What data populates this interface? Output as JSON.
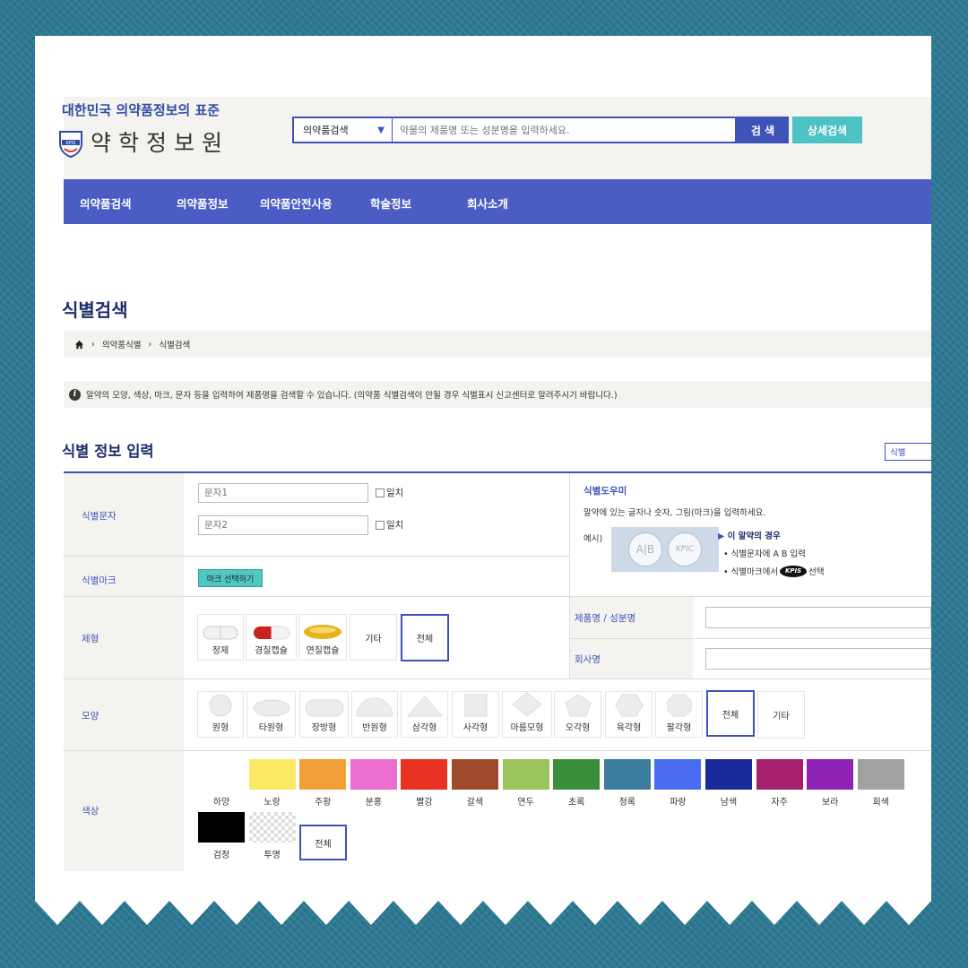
{
  "header": {
    "tagline": "대한민국 의약품정보의 표준",
    "logo_name": "약학정보원",
    "logo_emblem_text": "KPIS"
  },
  "search": {
    "category": "의약품검색",
    "placeholder": "약물의 제품명 또는 성분명을 입력하세요.",
    "search_button": "검 색",
    "advanced_button": "상세검색"
  },
  "nav": {
    "items": [
      "의약품검색",
      "의약품정보",
      "의약품안전사용",
      "학술정보",
      "회사소개"
    ]
  },
  "page": {
    "title": "식별검색",
    "breadcrumb": [
      "의약품식별",
      "식별검색"
    ],
    "info_icon": "i",
    "info": "알약의 모양, 색상, 마크, 문자 등을 입력하여 제품명을 검색할 수 있습니다. (의약품 식별검색이 안될 경우 식별표시 신고센터로 알려주시기 바랍니다.)",
    "section_title": "식별 정보 입력",
    "section_button": "식별"
  },
  "form": {
    "imprint_label": "식별문자",
    "imprint1_placeholder": "문자1",
    "imprint2_placeholder": "문자2",
    "exact_match": "일치",
    "mark_label": "식별마크",
    "mark_button": "마크 선택하기",
    "help": {
      "title": "식별도우미",
      "text": "알약에 있는 글자나 숫자, 그림(마크)을 입력하세요.",
      "example": "예시)",
      "pill1_text": "A|B",
      "pill2_text": "KPIC",
      "case_title": "이 알약의 경우",
      "bullet1": "• 식별문자에 A B 입력",
      "bullet2_prefix": "• 식별마크에서",
      "bullet2_badge": "KPIS",
      "bullet2_suffix": "선택"
    },
    "product_label": "제품명 / 성분명",
    "company_label": "회사명",
    "form_label": "제형",
    "form_types": [
      "정제",
      "경질캡슐",
      "연질캡슐",
      "기타",
      "전체"
    ],
    "shape_label": "모양",
    "shapes": [
      "원형",
      "타원형",
      "장방형",
      "반원형",
      "삼각형",
      "사각형",
      "마름모형",
      "오각형",
      "육각형",
      "팔각형",
      "전체",
      "기타"
    ],
    "color_label": "색상",
    "colors": [
      {
        "name": "하양",
        "hex": "#ffffff"
      },
      {
        "name": "노랑",
        "hex": "#fbe966"
      },
      {
        "name": "주황",
        "hex": "#f29f37"
      },
      {
        "name": "분홍",
        "hex": "#ec6fd0"
      },
      {
        "name": "빨강",
        "hex": "#e83222"
      },
      {
        "name": "갈색",
        "hex": "#a04a2c"
      },
      {
        "name": "연두",
        "hex": "#9ac45c"
      },
      {
        "name": "초록",
        "hex": "#3a8d3a"
      },
      {
        "name": "청록",
        "hex": "#3b7c9c"
      },
      {
        "name": "파랑",
        "hex": "#4a6cf0"
      },
      {
        "name": "남색",
        "hex": "#1b2a9a"
      },
      {
        "name": "자주",
        "hex": "#a5216c"
      },
      {
        "name": "보라",
        "hex": "#8d22b4"
      },
      {
        "name": "회색",
        "hex": "#a1a1a1"
      },
      {
        "name": "검정",
        "hex": "#000000"
      },
      {
        "name": "투명",
        "hex": "transparent"
      }
    ],
    "color_all": "전체"
  },
  "colors": {
    "primary": "#3e53b7",
    "nav_bg": "#4b5cc4",
    "accent": "#4cc2c4",
    "panel_bg": "#f4f3f0"
  }
}
